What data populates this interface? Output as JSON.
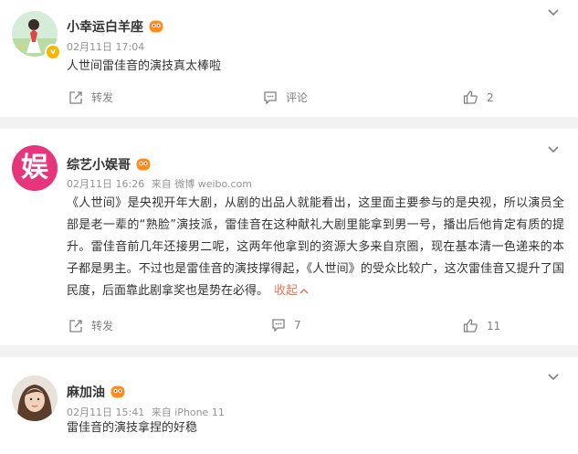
{
  "posts": [
    {
      "username": "小幸运白羊座",
      "date": "02月11日 17:04",
      "source": "",
      "text": "人世间雷佳音的演技真太棒啦",
      "actions": {
        "forward": "转发",
        "comment": "评论",
        "like": "2"
      }
    },
    {
      "username": "综艺小娱哥",
      "date": "02月11日 16:26",
      "source": "来自 微博 weibo.com",
      "text": "《人世间》是央视开年大剧，从剧的出品人就能看出，这里面主要参与的是央视，所以演员全部是老一辈的“熟脸”演技派，雷佳音在这种献礼大剧里能拿到男一号，播出后他肯定有质的提升。雷佳音前几年还接男二呢，这两年他拿到的资源大多来自京圈，现在基本清一色递来的本子都是男主。不过也是雷佳音的演技撑得起，《人世间》的受众比较广，这次雷佳音又提升了国民度，后面靠此剧拿奖也是势在必得。",
      "collapse_label": "收起",
      "actions": {
        "forward": "转发",
        "comment": "7",
        "like": "11"
      }
    },
    {
      "username": "麻加油",
      "date": "02月11日 15:41",
      "source": "来自 iPhone 11",
      "text": "雷佳音的演技拿捏的好稳"
    }
  ],
  "avatar_2_glyph": "娱",
  "verified_glyph": "v",
  "colors": {
    "accent": "#eb7350",
    "meta": "#939393",
    "background": "#f2f2f2",
    "avatar_pink": "#e6357a"
  }
}
